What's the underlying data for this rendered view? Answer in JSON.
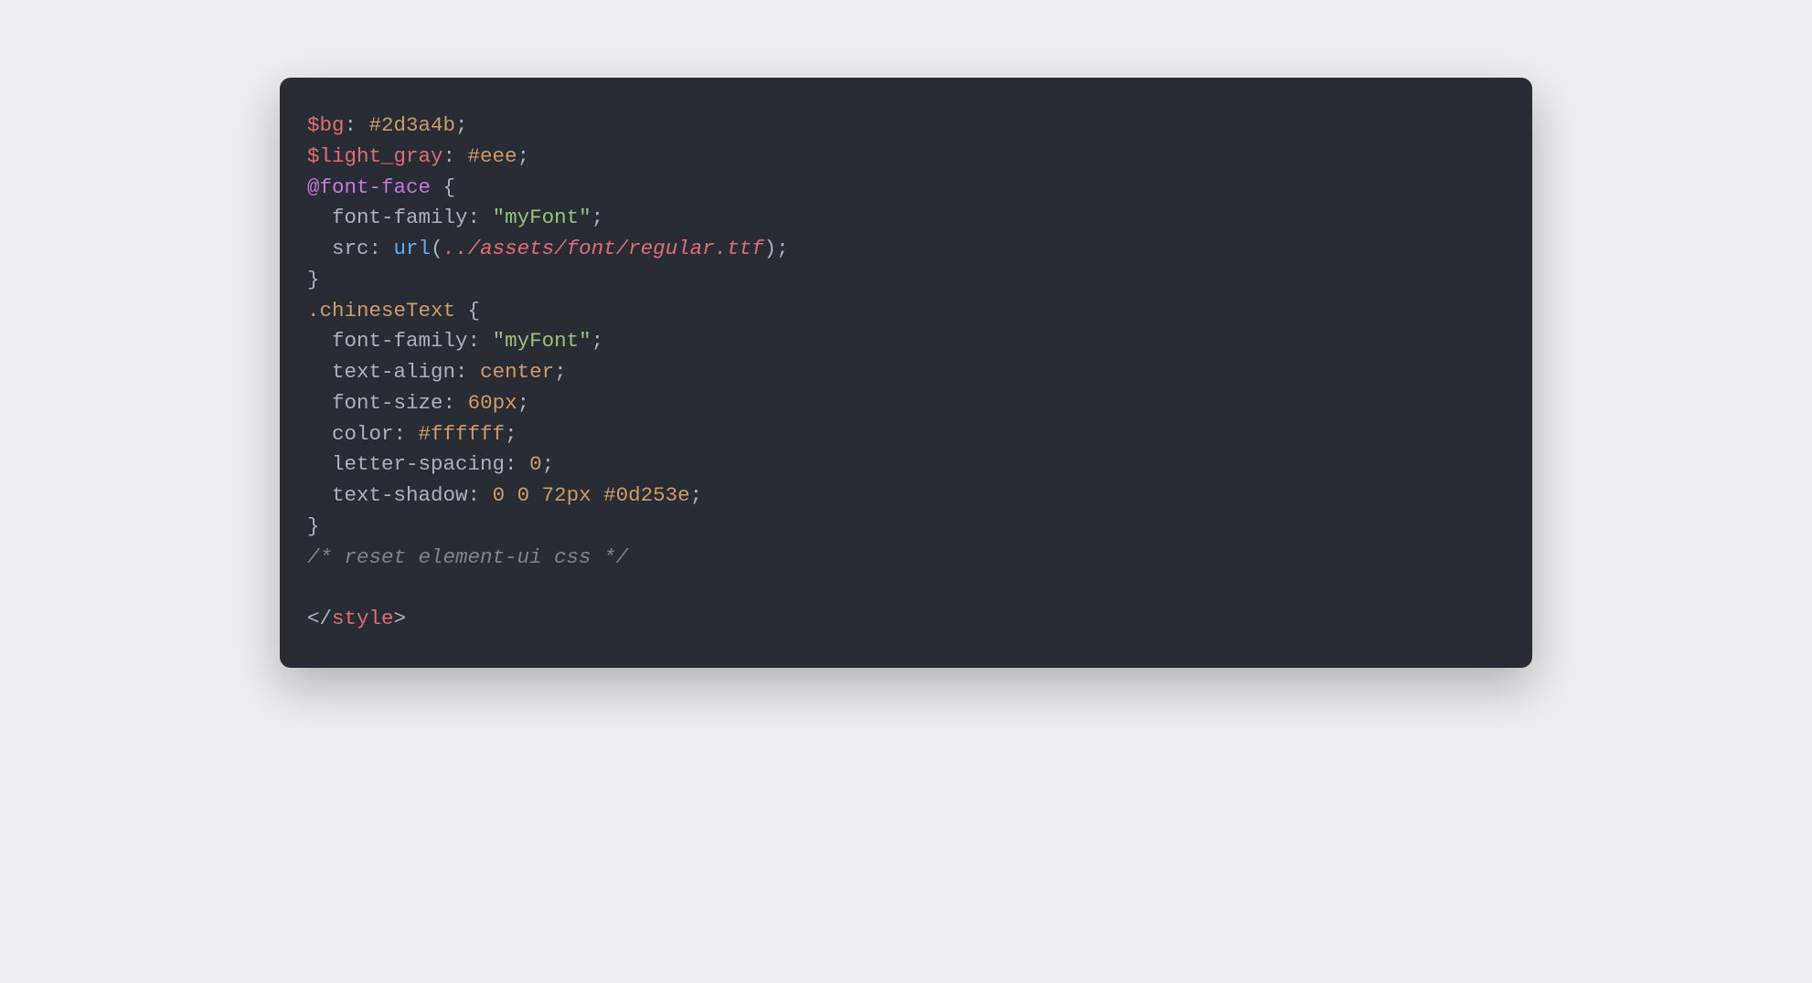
{
  "code": {
    "l1_var": "$bg",
    "l1_hex": "#2d3a4b",
    "l2_var": "$light_gray",
    "l2_hex": "#eee",
    "l3_atrule": "@font-face",
    "l4_prop": "font-family",
    "l4_str": "\"myFont\"",
    "l5_prop": "src",
    "l5_func": "url",
    "l5_arg": "../assets/font/regular.ttf",
    "l7_selector": ".chineseText",
    "l8_prop": "font-family",
    "l8_str": "\"myFont\"",
    "l9_prop": "text-align",
    "l9_val": "center",
    "l10_prop": "font-size",
    "l10_val": "60px",
    "l11_prop": "color",
    "l11_val": "#ffffff",
    "l12_prop": "letter-spacing",
    "l12_val": "0",
    "l13_prop": "text-shadow",
    "l13_v1": "0",
    "l13_v2": "0",
    "l13_v3": "72px",
    "l13_v4": "#0d253e",
    "l15_comment": "/* reset element-ui css */",
    "l17_tag": "style"
  }
}
